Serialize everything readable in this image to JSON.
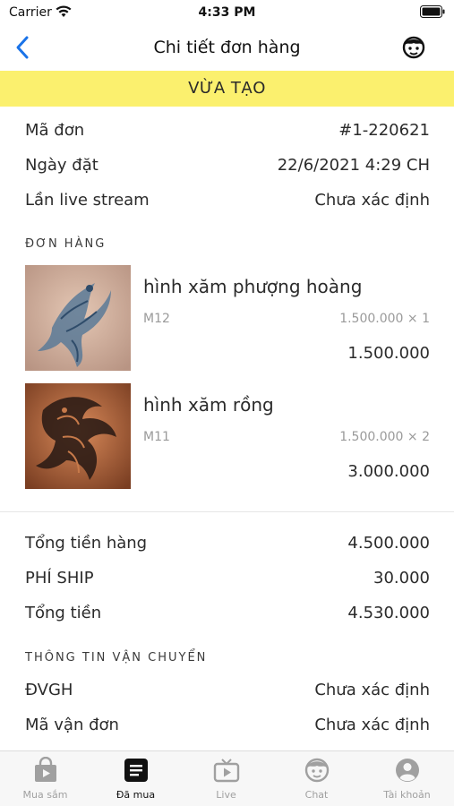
{
  "status_bar": {
    "carrier": "Carrier",
    "time": "4:33 PM"
  },
  "nav": {
    "title": "Chi tiết đơn hàng"
  },
  "order_status": "VỪA TẠO",
  "order_info": [
    {
      "label": "Mã đơn",
      "value": "#1-220621"
    },
    {
      "label": "Ngày đặt",
      "value": "22/6/2021 4:29 CH"
    },
    {
      "label": "Lần live stream",
      "value": "Chưa xác định"
    }
  ],
  "items_section": {
    "header": "ĐƠN HÀNG",
    "items": [
      {
        "name": "hình xăm phượng hoàng",
        "sku": "M12",
        "qty_price": "1.500.000 × 1",
        "total": "1.500.000",
        "image": "phoenix-tattoo"
      },
      {
        "name": "hình xăm rồng",
        "sku": "M11",
        "qty_price": "1.500.000 × 2",
        "total": "3.000.000",
        "image": "dragon-tattoo"
      }
    ]
  },
  "totals": [
    {
      "label": "Tổng tiền hàng",
      "value": "4.500.000"
    },
    {
      "label": "PHÍ SHIP",
      "value": "30.000"
    },
    {
      "label": "Tổng tiền",
      "value": "4.530.000"
    }
  ],
  "shipping_section": {
    "header": "THÔNG TIN VẬN CHUYỂN",
    "rows": [
      {
        "label": "ĐVGH",
        "value": "Chưa xác định"
      },
      {
        "label": "Mã vận đơn",
        "value": "Chưa xác định"
      }
    ]
  },
  "tabs": [
    {
      "label": "Mua sắm",
      "icon": "shopping-bag-icon",
      "active": false
    },
    {
      "label": "Đã mua",
      "icon": "receipt-icon",
      "active": true
    },
    {
      "label": "Live",
      "icon": "tv-icon",
      "active": false
    },
    {
      "label": "Chat",
      "icon": "chat-face-icon",
      "active": false
    },
    {
      "label": "Tài khoản",
      "icon": "account-icon",
      "active": false
    }
  ],
  "colors": {
    "banner": "#fbf06e",
    "accent": "#1a73e8",
    "tab_inactive": "#a0a0a0"
  }
}
